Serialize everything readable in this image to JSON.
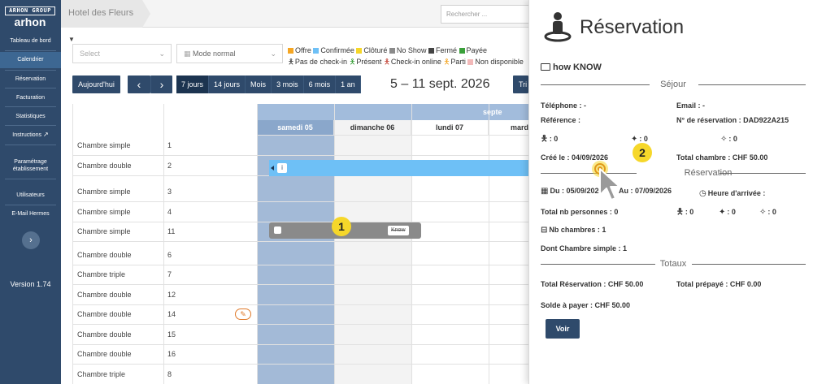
{
  "sidebar": {
    "logo_top": "ARHON GROUP",
    "logo_bottom": "arhon",
    "items": [
      {
        "label": "Tableau de bord"
      },
      {
        "label": "Calendrier"
      },
      {
        "label": "Réservation"
      },
      {
        "label": "Facturation"
      },
      {
        "label": "Statistiques"
      },
      {
        "label": "Instructions"
      },
      {
        "label": "Paramétrage établissement"
      },
      {
        "label": "Utilisateurs"
      },
      {
        "label": "E-Mail Hermes"
      }
    ],
    "version": "Version 1.74"
  },
  "topbar": {
    "hotel": "Hotel des Fleurs",
    "search_placeholder": "Rechercher ..."
  },
  "filters": {
    "select_placeholder": "Select",
    "mode": "Mode normal"
  },
  "legend": {
    "statuses": [
      {
        "label": "Offre",
        "color": "#f5a623"
      },
      {
        "label": "Confirmée",
        "color": "#6ec0f6"
      },
      {
        "label": "Clôturé",
        "color": "#f6d72a"
      },
      {
        "label": "No Show",
        "color": "#8a8a8a"
      },
      {
        "label": "Fermé",
        "color": "#444444"
      },
      {
        "label": "Payée",
        "color": "#3aa03a"
      }
    ],
    "presence": [
      {
        "label": "Pas de check-in",
        "color": "#333333"
      },
      {
        "label": "Présent",
        "color": "#3aa03a"
      },
      {
        "label": "Check-in online",
        "color": "#c0392b"
      },
      {
        "label": "Parti",
        "color": "#e8a8a8"
      },
      {
        "label": "Non disponible",
        "color": "#f2b8b8"
      }
    ]
  },
  "toolbar": {
    "today": "Aujourd'hui",
    "prev": "‹",
    "next": "›",
    "ranges": [
      "7 jours",
      "14 jours",
      "Mois",
      "3 mois",
      "6 mois",
      "1 an"
    ],
    "active_range": "7 jours",
    "date_range": "5 – 11 sept. 2026",
    "sort_button": "Tri"
  },
  "calendar": {
    "month_label": "septe",
    "days": [
      "samedi 05",
      "dimanche 06",
      "lundi 07",
      "mard"
    ],
    "rooms": [
      {
        "type": "Chambre simple",
        "number": "1"
      },
      {
        "type": "Chambre double",
        "number": "2"
      },
      {
        "type": "Chambre simple",
        "number": "3"
      },
      {
        "type": "Chambre simple",
        "number": "4"
      },
      {
        "type": "Chambre simple",
        "number": "11"
      },
      {
        "type": "Chambre double",
        "number": "6"
      },
      {
        "type": "Chambre triple",
        "number": "7"
      },
      {
        "type": "Chambre double",
        "number": "12"
      },
      {
        "type": "Chambre double",
        "number": "14"
      },
      {
        "type": "Chambre double",
        "number": "15"
      },
      {
        "type": "Chambre double",
        "number": "16"
      },
      {
        "type": "Chambre triple",
        "number": "8"
      }
    ],
    "booking_grey_tag": "Know",
    "marker_1": "1"
  },
  "panel": {
    "title": "Réservation",
    "guest": "how KNOW",
    "sejour": {
      "header": "Séjour",
      "telephone": "Téléphone : -",
      "email": "Email : -",
      "reference": "Référence :",
      "numero": "N° de réservation : DAD922A215",
      "adults": ": 0",
      "children": ": 0",
      "babies": ": 0",
      "created": "Créé le : 04/09/2026",
      "total_chambre": "Total chambre : CHF 50.00"
    },
    "reservation": {
      "header": "Réservation",
      "du": "Du : 05/09/2026",
      "au": "Au : 07/09/2026",
      "heure": "Heure d'arrivée :",
      "total_nb": "Total nb personnes : 0",
      "adults": ": 0",
      "children": ": 0",
      "babies": ": 0",
      "nb_chambres": "Nb chambres : 1",
      "dont": "Dont Chambre simple : 1"
    },
    "totaux": {
      "header": "Totaux",
      "total_reservation": "Total Réservation : CHF 50.00",
      "total_prepaye": "Total prépayé : CHF 0.00",
      "solde": "Solde à payer : CHF 50.00"
    },
    "voir": "Voir",
    "marker_2": "2"
  }
}
